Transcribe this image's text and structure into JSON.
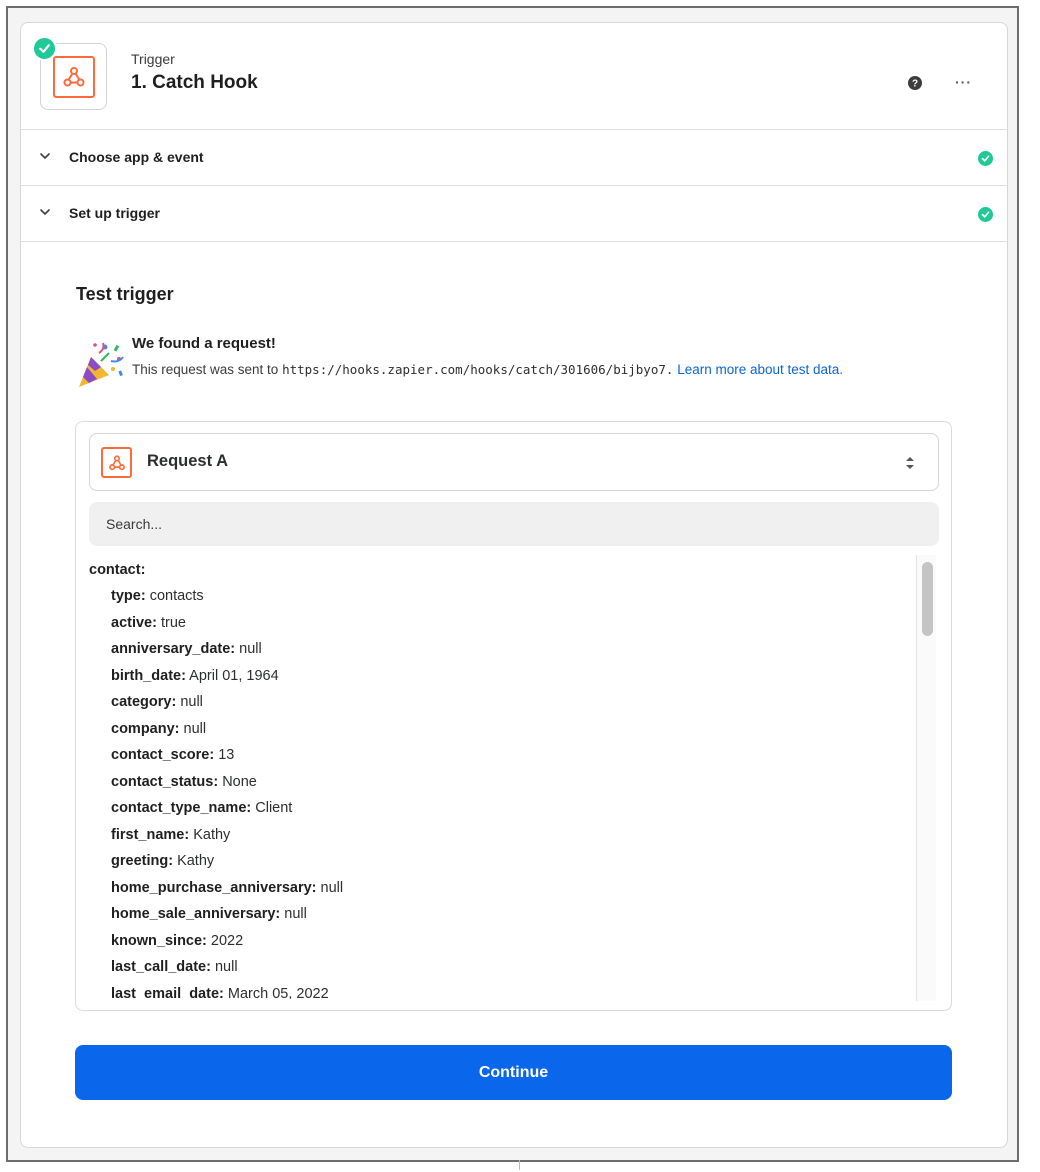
{
  "header": {
    "label": "Trigger",
    "title": "1. Catch Hook"
  },
  "sections": [
    {
      "label": "Choose app & event",
      "complete": true
    },
    {
      "label": "Set up trigger",
      "complete": true
    }
  ],
  "test": {
    "title": "Test trigger",
    "found_title": "We found a request!",
    "desc_prefix": "This request was sent to ",
    "url": "https://hooks.zapier.com/hooks/catch/301606/bijbyo7.",
    "link_text": "Learn more about test data."
  },
  "request": {
    "selected": "Request A"
  },
  "search": {
    "placeholder": "Search..."
  },
  "data": {
    "root_key": "contact:",
    "fields": [
      {
        "key": "type:",
        "value": "contacts"
      },
      {
        "key": "active:",
        "value": "true"
      },
      {
        "key": "anniversary_date:",
        "value": "null"
      },
      {
        "key": "birth_date:",
        "value": "April 01, 1964"
      },
      {
        "key": "category:",
        "value": "null"
      },
      {
        "key": "company:",
        "value": "null"
      },
      {
        "key": "contact_score:",
        "value": "13"
      },
      {
        "key": "contact_status:",
        "value": "None"
      },
      {
        "key": "contact_type_name:",
        "value": "Client"
      },
      {
        "key": "first_name:",
        "value": "Kathy"
      },
      {
        "key": "greeting:",
        "value": "Kathy"
      },
      {
        "key": "home_purchase_anniversary:",
        "value": "null"
      },
      {
        "key": "home_sale_anniversary:",
        "value": "null"
      },
      {
        "key": "known_since:",
        "value": "2022"
      },
      {
        "key": "last_call_date:",
        "value": "null"
      },
      {
        "key": "last_email_date:",
        "value": "March 05, 2022"
      }
    ]
  },
  "footer": {
    "continue_label": "Continue"
  },
  "colors": {
    "accent": "#0a66ea",
    "success": "#20c997",
    "webhook": "#ff6a3d"
  }
}
